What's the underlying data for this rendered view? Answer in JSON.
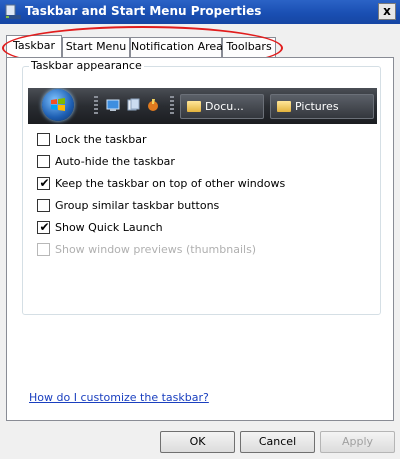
{
  "window": {
    "title": "Taskbar and Start Menu Properties",
    "close_label": "x"
  },
  "tabs": [
    {
      "label": "Taskbar",
      "active": true
    },
    {
      "label": "Start Menu",
      "active": false
    },
    {
      "label": "Notification Area",
      "active": false
    },
    {
      "label": "Toolbars",
      "active": false
    }
  ],
  "annotation": {
    "color": "#e11d1d",
    "shape": "ellipse around tabs"
  },
  "group": {
    "label": "Taskbar appearance",
    "preview": {
      "task_buttons": [
        {
          "label": "Docu...",
          "icon": "folder-icon"
        },
        {
          "label": "Pictures",
          "icon": "folder-icon"
        }
      ]
    }
  },
  "checkboxes": [
    {
      "label": "Lock the taskbar",
      "checked": false,
      "disabled": false
    },
    {
      "label": "Auto-hide the taskbar",
      "checked": false,
      "disabled": false
    },
    {
      "label": "Keep the taskbar on top of other windows",
      "checked": true,
      "disabled": false
    },
    {
      "label": "Group similar taskbar buttons",
      "checked": false,
      "disabled": false
    },
    {
      "label": "Show Quick Launch",
      "checked": true,
      "disabled": false
    },
    {
      "label": "Show window previews (thumbnails)",
      "checked": false,
      "disabled": true
    }
  ],
  "help_link": "How do I customize the taskbar?",
  "buttons": {
    "ok": "OK",
    "cancel": "Cancel",
    "apply": "Apply",
    "apply_disabled": true
  }
}
